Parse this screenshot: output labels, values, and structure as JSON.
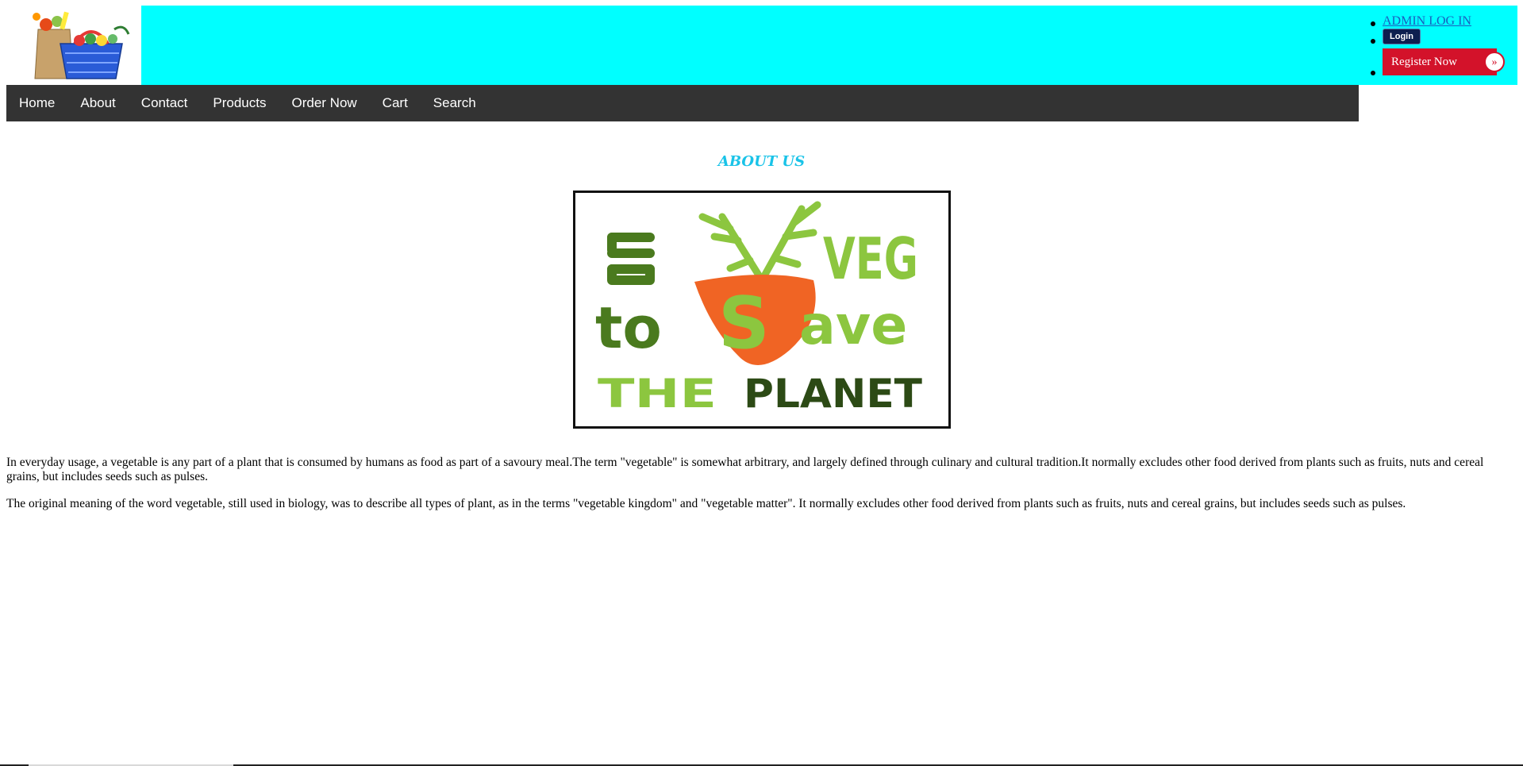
{
  "header": {
    "admin_link": "ADMIN LOG IN",
    "login_label": "Login",
    "register_label": "Register Now"
  },
  "nav": {
    "items": [
      "Home",
      "About",
      "Contact",
      "Products",
      "Order Now",
      "Cart",
      "Search"
    ]
  },
  "main": {
    "title": "ABOUT US",
    "image_text": {
      "line1": "VEG",
      "line2_left": "to",
      "line2_mid": "S",
      "line2_right": "ave",
      "line3_left": "THE",
      "line3_right": "PLANET"
    },
    "paragraphs": [
      "In everyday usage, a vegetable is any part of a plant that is consumed by humans as food as part of a savoury meal.The term \"vegetable\" is somewhat arbitrary, and largely defined through culinary and cultural tradition.It normally excludes other food derived from plants such as fruits, nuts and cereal grains, but includes seeds such as pulses.",
      "The original meaning of the word vegetable, still used in biology, was to describe all types of plant, as in the terms \"vegetable kingdom\" and \"vegetable matter\". It normally excludes other food derived from plants such as fruits, nuts and cereal grains, but includes seeds such as pulses."
    ]
  },
  "colors": {
    "header_bg": "#00ffff",
    "nav_bg": "#333333",
    "title_color": "#19c3e8",
    "register_bg": "#d3122a",
    "veg_green_dark": "#4a7a1e",
    "veg_green_light": "#8cc63f",
    "carrot_orange": "#f06424"
  },
  "icons": {
    "logo": "grocery-basket-icon",
    "register_chevron": "double-chevron-right-icon"
  }
}
